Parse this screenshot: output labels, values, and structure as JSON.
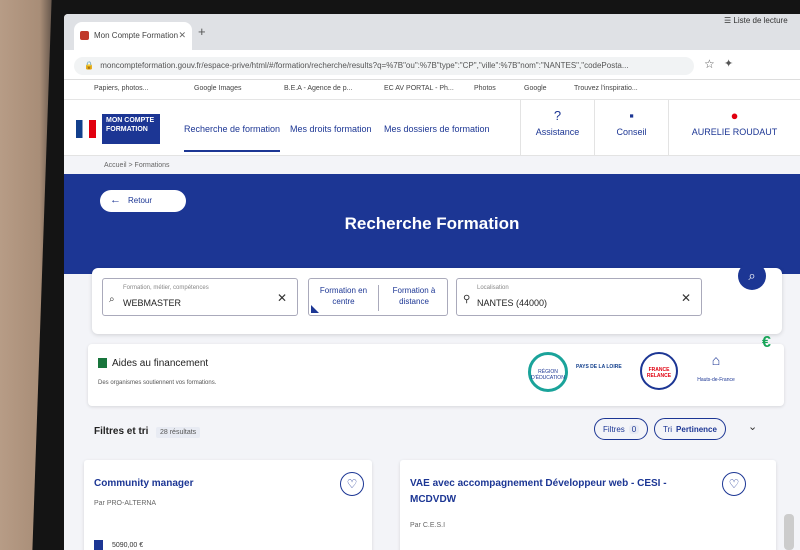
{
  "browser": {
    "tab_title": "Mon Compte Formation",
    "new_tab": "+",
    "url": "moncompteformation.gouv.fr/espace-prive/html/#/formation/recherche/results?q=%7B\"ou\":%7B\"type\":\"CP\",\"ville\":%7B\"nom\":\"NANTES\",\"codePosta...",
    "reading_list": "Liste de lecture",
    "bookmarks": [
      "Papiers, photos...",
      "Google Images",
      "B.E.A - Agence de p...",
      "EC AV PORTAL - Ph...",
      "Photos",
      "Google",
      "Trouvez l'inspiratio..."
    ]
  },
  "header": {
    "logo_text": "MON COMPTE FORMATION",
    "nav": [
      "Recherche de formation",
      "Mes droits formation",
      "Mes dossiers de formation"
    ],
    "assistance": "Assistance",
    "conseil": "Conseil",
    "user": "AURELIE ROUDAUT"
  },
  "breadcrumb": "Accueil > Formations",
  "hero": {
    "back": "Retour",
    "title": "Recherche Formation"
  },
  "search": {
    "query_label": "Formation, métier, compétences",
    "query_value": "WEBMASTER",
    "mode_center": "Formation en centre",
    "mode_remote": "Formation à distance",
    "loc_label": "Localisation",
    "loc_value": "NANTES (44000)"
  },
  "financing": {
    "title": "Aides au financement",
    "subtitle": "Des organismes soutiennent vos formations.",
    "partners": [
      "RÉGION D'ÉDUCATION",
      "PAYS DE LA LOIRE",
      "FRANCE RELANCE",
      "Hauts-de-France"
    ],
    "euro": "€"
  },
  "filters": {
    "title": "Filtres et tri",
    "results": "28 résultats",
    "filters_label": "Filtres",
    "filters_count": "0",
    "sort_label": "Tri",
    "sort_value": "Pertinence"
  },
  "results": [
    {
      "title": "Community manager",
      "org": "Par PRO-ALTERNA",
      "price": "5090,00 €"
    },
    {
      "title": "VAE avec accompagnement Développeur web - CESI - MCDVDW",
      "org": "Par C.E.S.I"
    }
  ]
}
